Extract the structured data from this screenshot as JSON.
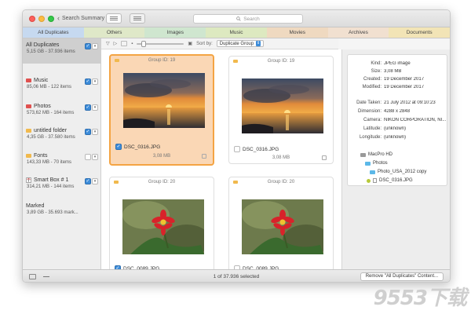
{
  "window": {
    "back_label": "Search Summary",
    "search_placeholder": "Search"
  },
  "tabs": [
    {
      "label": "All Duplicates",
      "color": "#c6d9f0",
      "selected": true
    },
    {
      "label": "Others",
      "color": "#dfe8c8"
    },
    {
      "label": "Images",
      "color": "#cfe6cf"
    },
    {
      "label": "Music",
      "color": "#dde9c0"
    },
    {
      "label": "Movies",
      "color": "#efd9c0"
    },
    {
      "label": "Archives",
      "color": "#f1e0d0"
    },
    {
      "label": "Documents",
      "color": "#f2e4b6"
    }
  ],
  "sidebar": {
    "items": [
      {
        "name": "All Duplicates",
        "detail": "5,15 GB - 37.936 items",
        "icon": "none",
        "checked": true,
        "selected": true
      },
      {
        "name": "Music",
        "detail": "85,06 MB - 122 items",
        "icon": "folder-icon",
        "color": "#e0514f",
        "checked": true
      },
      {
        "name": "Photos",
        "detail": "573,62 MB - 164 items",
        "icon": "folder-icon",
        "color": "#e0514f",
        "checked": true
      },
      {
        "name": "untitled folder",
        "detail": "4,35 GB - 37.580 items",
        "icon": "folder-icon",
        "color": "#f1b94d",
        "checked": true
      },
      {
        "name": "Fonts",
        "detail": "143,33 MB - 70 items",
        "icon": "folder-icon",
        "color": "#f1b94d",
        "checked": false
      },
      {
        "name": "Smart Box # 1",
        "detail": "314,21 MB - 144 items",
        "icon": "smart-box-icon",
        "color": "#e0514f",
        "checked": true
      },
      {
        "name": "Marked",
        "detail": "3,89 GB - 35.693 mark...",
        "icon": "none"
      }
    ]
  },
  "toolbar": {
    "sort_label": "Sort by:",
    "sort_value": "Duplicate Group"
  },
  "groups": [
    {
      "header": "Group ID: 19",
      "file": "DSC_0316.JPG",
      "size": "3,08 MB",
      "checked": true,
      "selected": true,
      "photo": "sunset"
    },
    {
      "header": "Group ID: 19",
      "file": "DSC_0316.JPG",
      "size": "3,08 MB",
      "checked": false,
      "selected": false,
      "photo": "sunset"
    },
    {
      "header": "Group ID: 20",
      "file": "DSC_0089.JPG",
      "size": "",
      "checked": true,
      "selected": false,
      "photo": "flower"
    },
    {
      "header": "Group ID: 20",
      "file": "DSC_0089.JPG",
      "size": "",
      "checked": false,
      "selected": false,
      "photo": "flower"
    }
  ],
  "info": {
    "general": [
      {
        "k": "Kind:",
        "v": "JPEG image"
      },
      {
        "k": "Size:",
        "v": "3,08 MB"
      },
      {
        "k": "Created:",
        "v": "19 December 2017"
      },
      {
        "k": "Modified:",
        "v": "19 December 2017"
      }
    ],
    "exif": [
      {
        "k": "Date Taken:",
        "v": "21 July 2012 at 09:10:23"
      },
      {
        "k": "Dimension:",
        "v": "4288 x 2848"
      },
      {
        "k": "Camera:",
        "v": "NIKON CORPORATION, NI..."
      },
      {
        "k": "Latitude:",
        "v": "(unknown)"
      },
      {
        "k": "Longitude:",
        "v": "(unknown)"
      }
    ],
    "path": [
      "MacPro HD",
      "Photos",
      "Photo_USA_2012 copy",
      "DSC_0316.JPG"
    ]
  },
  "status": {
    "text": "1 of 37.936 selected",
    "remove_button": "Remove \"All Duplicates\" Content..."
  },
  "watermark": "9553下载"
}
